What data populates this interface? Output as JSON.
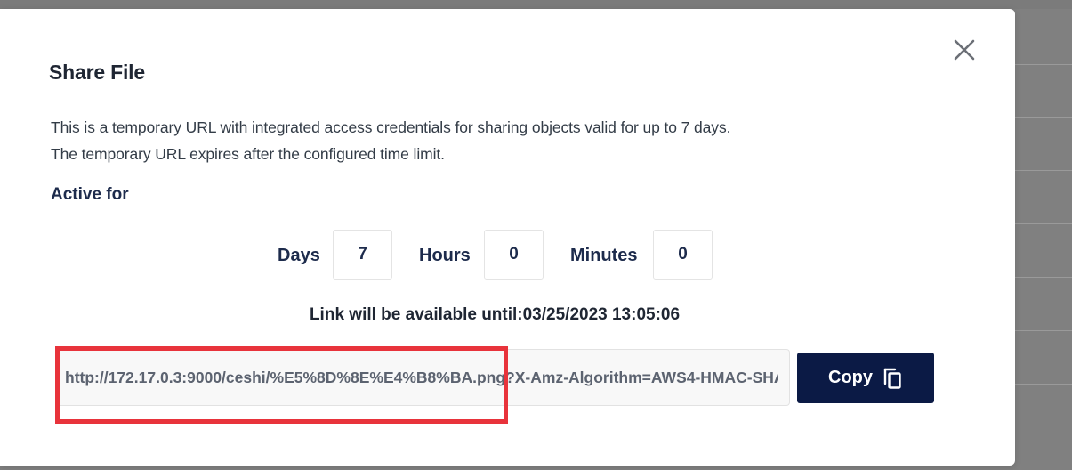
{
  "modal": {
    "title": "Share File",
    "description_line1": "This is a temporary URL with integrated access credentials for sharing objects valid for up to 7 days.",
    "description_line2": "The temporary URL expires after the configured time limit.",
    "active_for_label": "Active for",
    "duration": {
      "days_label": "Days",
      "days_value": "7",
      "hours_label": "Hours",
      "hours_value": "0",
      "minutes_label": "Minutes",
      "minutes_value": "0"
    },
    "expiry_text": "Link will be available until:03/25/2023 13:05:06",
    "url": "http://172.17.0.3:9000/ceshi/%E5%8D%8E%E4%B8%BA.png?X-Amz-Algorithm=AWS4-HMAC-SHA",
    "copy_label": "Copy",
    "icons": {
      "close": "close-icon",
      "copy": "copy-icon"
    }
  },
  "colors": {
    "primary_button": "#0b1a45",
    "highlight": "#e8333b",
    "heading": "#1d2b4c"
  }
}
